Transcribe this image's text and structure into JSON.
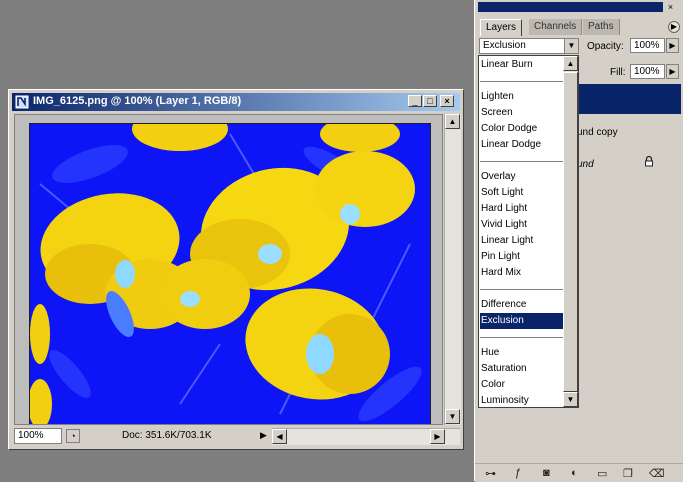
{
  "document": {
    "title": "IMG_6125.png @ 100% (Layer 1, RGB/8)",
    "zoom": "100%",
    "doc_info": "Doc: 351.6K/703.1K"
  },
  "palette": {
    "tabs": [
      "Layers",
      "Channels",
      "Paths"
    ],
    "blend_mode": "Exclusion",
    "opacity_label": "Opacity:",
    "opacity_value": "100%",
    "fill_label": "Fill:",
    "fill_value": "100%",
    "layer_partial_1": "und copy",
    "layer_partial_2": "und"
  },
  "blend_menu": {
    "items": [
      "Linear Burn",
      "Lighten",
      "Screen",
      "Color Dodge",
      "Linear Dodge",
      "Overlay",
      "Soft Light",
      "Hard Light",
      "Vivid Light",
      "Linear Light",
      "Pin Light",
      "Hard Mix",
      "Difference",
      "Exclusion",
      "Hue",
      "Saturation",
      "Color",
      "Luminosity"
    ],
    "selected": "Exclusion"
  },
  "icons": [
    "app-icon",
    "minimize-icon",
    "maximize-icon",
    "close-icon",
    "lock-icon",
    "palette-menu-icon"
  ]
}
